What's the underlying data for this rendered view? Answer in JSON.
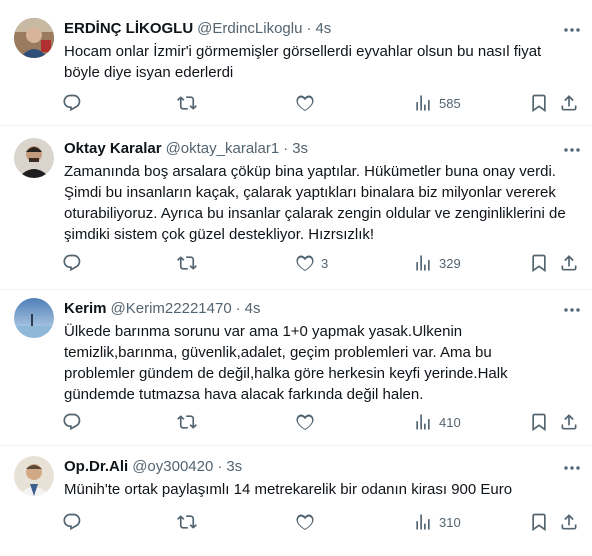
{
  "tweets": [
    {
      "name": "ERDİNÇ LİKOGLU",
      "handle": "@ErdincLikoglu",
      "time": "4s",
      "text": "Hocam onlar İzmir'i görmemişler görsellerdi eyvahlar olsun bu nasıl fiyat\nböyle diye isyan ederlerdi",
      "likes": "",
      "views": "585"
    },
    {
      "name": "Oktay Karalar",
      "handle": "@oktay_karalar1",
      "time": "3s",
      "text": "Zamanında boş arsalara çöküp bina yaptılar. Hükümetler buna onay verdi.\nŞimdi bu insanların kaçak, çalarak yaptıkları binalara biz milyonlar vererek\noturabiliyoruz. Ayrıca bu insanlar çalarak zengin oldular ve zenginliklerini de\nşimdiki sistem çok güzel destekliyor. Hızrsızlık!",
      "likes": "3",
      "views": "329"
    },
    {
      "name": "Kerim",
      "handle": "@Kerim22221470",
      "time": "4s",
      "text": "Ülkede barınma sorunu var ama 1+0 yapmak yasak.Ulkenin\ntemizlik,barınma, güvenlik,adalet, geçim problemleri var. Ama bu\nproblemler gündem de değil,halka göre herkesin keyfi yerinde.Halk\ngündemde tutmazsa hava alacak farkında değil halen.",
      "likes": "",
      "views": "410"
    },
    {
      "name": "Op.Dr.Ali",
      "handle": "@oy300420",
      "time": "3s",
      "text": "Münih'te ortak paylaşımlı 14 metrekarelik bir odanın kirası 900 Euro",
      "likes": "",
      "views": "310"
    }
  ],
  "separator": "·",
  "icons": [
    "reply-icon",
    "retweet-icon",
    "like-icon",
    "views-icon",
    "bookmark-icon",
    "share-icon",
    "more-icon"
  ],
  "colors": {
    "text": "#0f1419",
    "secondary": "#536471",
    "divider": "#eff3f4"
  }
}
